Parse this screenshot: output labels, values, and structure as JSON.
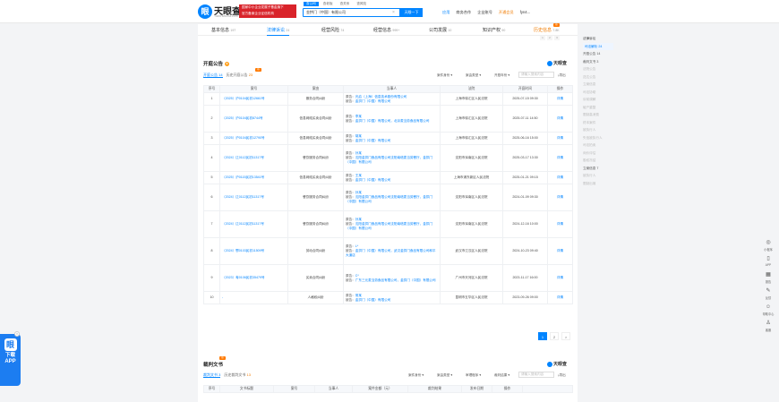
{
  "header": {
    "logo_cn": "天眼查",
    "logo_url": "TianYanCha.com",
    "promo_lines": [
      "国家中小企业发展子基金旗下",
      "官方备案企业征信机构"
    ],
    "search_tabs": [
      "查公司",
      "查老板",
      "查关系",
      "查风险"
    ],
    "search_value": "金拱门（中国）有限公司",
    "clear_icon": "×",
    "search_button": "天眼一下",
    "nav": [
      "应用",
      "商务合作",
      "企业账号",
      "开通会员",
      "fyn4..."
    ]
  },
  "tabs": [
    {
      "label": "基本信息",
      "count": "197"
    },
    {
      "label": "法律诉讼",
      "count": "24"
    },
    {
      "label": "经营风险",
      "count": "74"
    },
    {
      "label": "经营信息",
      "count": "999+"
    },
    {
      "label": "公司发展",
      "count": "10"
    },
    {
      "label": "知识产权",
      "count": "90"
    },
    {
      "label": "历史信息",
      "count": "7.8K"
    }
  ],
  "tab_hot": "热",
  "mini_pager": [
    "1",
    "2",
    "3"
  ],
  "section1": {
    "title": "开庭公告",
    "badge": "8",
    "brand": "天眼查",
    "subtab_on": "开庭公告 14",
    "subtab_off_label": "历史开庭公告",
    "subtab_off_num": "23",
    "hot": "热",
    "filters": [
      "案件身份",
      "案由类型",
      "开庭年份"
    ],
    "search_placeholder": "请输入搜索内容",
    "export": "导出",
    "columns": [
      "序号",
      "案号",
      "案由",
      "当事人",
      "法院",
      "开庭时间",
      "操作"
    ],
    "rows": [
      {
        "no": "1",
        "case": "（2025）沪0104民初12661号",
        "cause": "服务合同纠纷",
        "parties": [
          [
            "原告：",
            "光启（上海）信息技术股份有限公司"
          ],
          [
            "被告：",
            "金拱门（中国）有限公司"
          ]
        ],
        "court": "上海市徐汇区人民法院",
        "time": "2025-07-15 09:30",
        "op": "详情"
      },
      {
        "no": "2",
        "case": "（2025）沪0104民初8744号",
        "cause": "信息网络买卖合同纠纷",
        "parties": [
          [
            "原告：",
            "李某"
          ],
          [
            "被告：",
            "金拱门（中国）有限公司，北京麦当劳食品有限公司"
          ]
        ],
        "court": "上海市徐汇区人民法院",
        "time": "2025-07-11 14:50",
        "op": "详情"
      },
      {
        "no": "3",
        "case": "（2025）沪0104民初12790号",
        "cause": "信息网络买卖合同纠纷",
        "parties": [
          [
            "原告：",
            "胡某"
          ],
          [
            "被告：",
            "金拱门（中国）有限公司"
          ]
        ],
        "court": "上海市徐汇区人民法院",
        "time": "2025-06-16 15:00",
        "op": "详情"
      },
      {
        "no": "4",
        "case": "（2024）辽0112民初11317号",
        "cause": "餐饮服务合同纠纷",
        "parties": [
          [
            "原告：",
            "孙某"
          ],
          [
            "被告：",
            "沈阳金拱门食品有限公司沈阳南塔麦当劳餐厅，金拱门（中国）有限公司"
          ]
        ],
        "court": "沈阳市浑南区人民法院",
        "time": "2025-03-17 13:30",
        "op": "详情"
      },
      {
        "no": "5",
        "case": "（2025）沪0115民初13541号",
        "cause": "信息网络买卖合同纠纷",
        "parties": [
          [
            "原告：",
            "王某"
          ],
          [
            "被告：",
            "金拱门（中国）有限公司"
          ]
        ],
        "court": "上海市浦东新区人民法院",
        "time": "2025-01-21 09:15",
        "op": "详情"
      },
      {
        "no": "6",
        "case": "（2024）辽0112民初11317号",
        "cause": "餐饮服务合同纠纷",
        "parties": [
          [
            "原告：",
            "孙某"
          ],
          [
            "被告：",
            "沈阳金拱门食品有限公司沈阳南塔麦当劳餐厅，金拱门（中国）有限公司"
          ]
        ],
        "court": "沈阳市浑南区人民法院",
        "time": "2024-01-09 09:30",
        "op": "详情"
      },
      {
        "no": "7",
        "case": "（2024）辽0112民初11317号",
        "cause": "餐饮服务合同纠纷",
        "parties": [
          [
            "原告：",
            "孙某"
          ],
          [
            "被告：",
            "沈阳金拱门食品有限公司沈阳南塔麦当劳餐厅，金拱门（中国）有限公司"
          ]
        ],
        "court": "沈阳市浑南区人民法院",
        "time": "2024-12-16 10:00",
        "op": "详情"
      },
      {
        "no": "8",
        "case": "（2024）鄂0103民初11509号",
        "cause": "劳动合同纠纷",
        "parties": [
          [
            "原告：",
            "L*"
          ],
          [
            "被告：",
            "金拱门（中国）有限公司，武汉金拱门食品有限公司和平大道店"
          ]
        ],
        "court": "武汉市江汉区人民法院",
        "time": "2024-10-23 09:40",
        "op": "详情"
      },
      {
        "no": "9",
        "case": "（2023）粤0106民初35479号",
        "cause": "买卖合同纠纷",
        "parties": [
          [
            "原告：",
            "C*"
          ],
          [
            "被告：",
            "广东三元麦当劳食品有限公司，金拱门（中国）有限公司"
          ]
        ],
        "court": "广州市天河区人民法院",
        "time": "2023-11-17 16:00",
        "op": "详情"
      },
      {
        "no": "10",
        "case": "-",
        "cause": "人格权纠纷",
        "parties": [
          [
            "原告：",
            "常某"
          ],
          [
            "被告：",
            "金拱门（中国）有限公司"
          ]
        ],
        "court": "昆明市五华区人民法院",
        "time": "2023-09-26 09:00",
        "op": "详情"
      }
    ]
  },
  "pager": [
    "1",
    "2",
    ">"
  ],
  "section2": {
    "title": "裁判文书",
    "hot": "热",
    "brand": "天眼查",
    "subtab_on": "裁判文书 3",
    "subtab_off_label": "历史裁判文书",
    "subtab_off_num": "13",
    "filters": [
      "案件身份",
      "案由类型",
      "审理程序",
      "裁判结果"
    ],
    "search_placeholder": "请输入搜索内容",
    "export": "导出",
    "columns": [
      "序号",
      "文书标题",
      "案号",
      "当事人",
      "案件金额（元）",
      "裁判结果",
      "发布日期",
      "操作"
    ]
  },
  "right_nav": {
    "head": "法律诉讼",
    "items": [
      "司法解析 24",
      "开庭公告 14",
      "裁判文书 3",
      "法院公告",
      "送达公告",
      "立案信息",
      "司法协助",
      "诉前调解",
      "破产重整",
      "限制高消费",
      "终本案件",
      "被执行人",
      "失信被执行人",
      "司法拍卖",
      "询价评估",
      "股权冻结",
      "立案信息 7",
      "被执行人",
      "限制出境"
    ]
  },
  "float_bar": [
    {
      "icon": "◎",
      "label": "小程序"
    },
    {
      "icon": "▯",
      "label": "APP"
    },
    {
      "icon": "▦",
      "label": "报告"
    },
    {
      "icon": "✎",
      "label": "反馈"
    },
    {
      "icon": "☺",
      "label": "帮助中心"
    },
    {
      "icon": "♙",
      "label": "客服"
    }
  ],
  "app_promo": {
    "line1": "下载",
    "line2": "APP",
    "icon": "眼",
    "close": "×"
  }
}
